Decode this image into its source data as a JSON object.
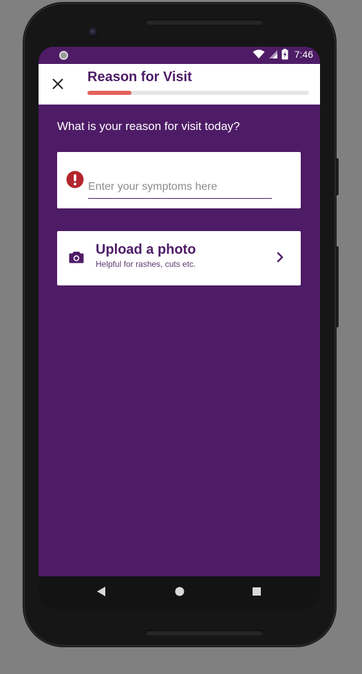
{
  "status_bar": {
    "time": "7:46",
    "icons": [
      "notification-dot-icon",
      "wifi-icon",
      "cellular-signal-icon",
      "battery-charging-icon"
    ]
  },
  "app_bar": {
    "title": "Reason for Visit",
    "close_icon": "close-icon",
    "progress_fraction": 0.2
  },
  "main": {
    "question": "What is your reason for visit today?",
    "symptoms": {
      "placeholder": "Enter your symptoms here",
      "value": "",
      "status_icon": "error-alert-icon"
    },
    "upload": {
      "title": "Upload a photo",
      "subtitle": "Helpful for rashes, cuts etc.",
      "icon": "camera-icon",
      "action_icon": "chevron-right-icon"
    }
  },
  "nav_bar": {
    "buttons": [
      "back-triangle-icon",
      "home-circle-icon",
      "recents-square-icon"
    ]
  },
  "colors": {
    "brand_purple": "#4e1c66",
    "progress_accent": "#e2635c",
    "error_red": "#b3262d",
    "surface": "#ffffff"
  }
}
